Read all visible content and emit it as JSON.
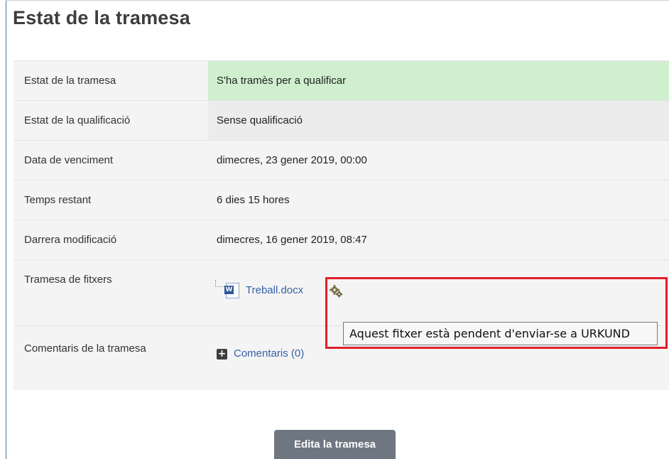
{
  "page": {
    "title": "Estat de la tramesa"
  },
  "rows": [
    {
      "label": "Estat de la tramesa",
      "value": "S'ha tramès per a qualificar"
    },
    {
      "label": "Estat de la qualificació",
      "value": "Sense qualificació"
    },
    {
      "label": "Data de venciment",
      "value": "dimecres, 23 gener 2019, 00:00"
    },
    {
      "label": "Temps restant",
      "value": "6 dies 15 hores"
    },
    {
      "label": "Darrera modificació",
      "value": "dimecres, 16 gener 2019, 08:47"
    }
  ],
  "files_row": {
    "label": "Tramesa de fitxers",
    "file_name": "Treball.docx",
    "file_icon": "word-document-icon",
    "file_icon_text": "W",
    "status_icon": "gear-icon"
  },
  "comments_row": {
    "label": "Comentaris de la tramesa",
    "link": "Comentaris (0)",
    "icon": "plus-square-icon",
    "icon_text": "+"
  },
  "tooltip": {
    "text": "Aquest fitxer està pendent d'enviar-se a URKUND"
  },
  "actions": {
    "edit_label": "Edita la tramesa"
  },
  "colors": {
    "submitted_bg": "#cfefcf",
    "link": "#3560a8",
    "highlight": "#e0202a",
    "button": "#6e7681"
  }
}
